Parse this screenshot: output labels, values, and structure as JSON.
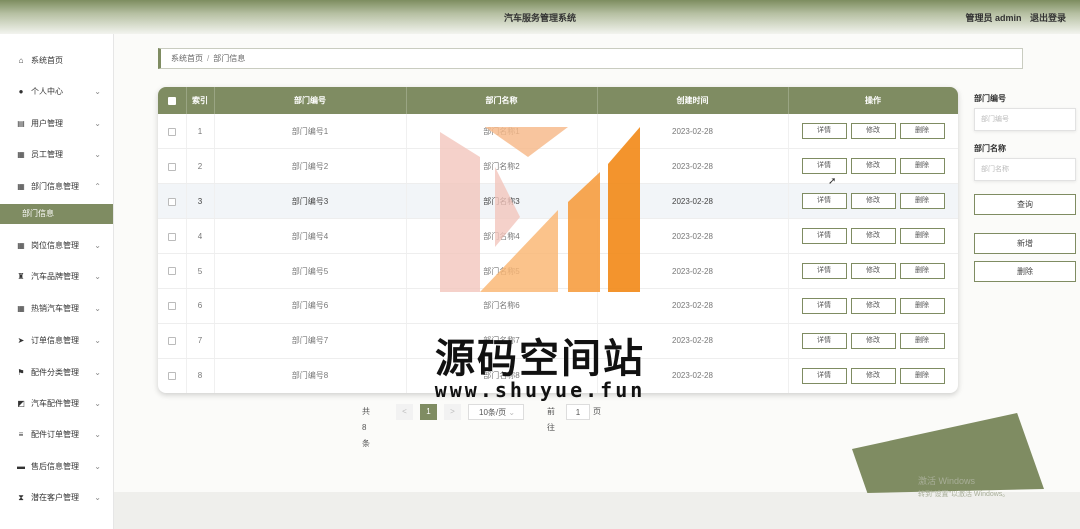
{
  "header": {
    "title": "汽车服务管理系统",
    "user_label": "管理员 admin",
    "logout": "退出登录"
  },
  "sidebar": {
    "items": [
      {
        "label": "系统首页",
        "icon": "home-icon",
        "glyph": "⌂",
        "has_arrow": false
      },
      {
        "label": "个人中心",
        "icon": "user-icon",
        "glyph": "●",
        "has_arrow": true
      },
      {
        "label": "用户管理",
        "icon": "doc-icon",
        "glyph": "▤",
        "has_arrow": true
      },
      {
        "label": "员工管理",
        "icon": "grid-icon",
        "glyph": "▦",
        "has_arrow": true
      },
      {
        "label": "部门信息管理",
        "icon": "grid-icon",
        "glyph": "▦",
        "has_arrow": true,
        "expanded": true
      },
      {
        "label": "部门信息",
        "icon": "",
        "glyph": "",
        "has_arrow": false,
        "active": true
      },
      {
        "label": "岗位信息管理",
        "icon": "grid-icon",
        "glyph": "▦",
        "has_arrow": true
      },
      {
        "label": "汽车品牌管理",
        "icon": "trophy-icon",
        "glyph": "♜",
        "has_arrow": true
      },
      {
        "label": "热销汽车管理",
        "icon": "grid-icon",
        "glyph": "▦",
        "has_arrow": true
      },
      {
        "label": "订单信息管理",
        "icon": "send-icon",
        "glyph": "➤",
        "has_arrow": true
      },
      {
        "label": "配件分类管理",
        "icon": "flag-icon",
        "glyph": "⚑",
        "has_arrow": true
      },
      {
        "label": "汽车配件管理",
        "icon": "chart-icon",
        "glyph": "◩",
        "has_arrow": true
      },
      {
        "label": "配件订单管理",
        "icon": "list-icon",
        "glyph": "≡",
        "has_arrow": true
      },
      {
        "label": "售后信息管理",
        "icon": "chat-icon",
        "glyph": "▬",
        "has_arrow": true
      },
      {
        "label": "潜在客户管理",
        "icon": "hourglass-icon",
        "glyph": "⧗",
        "has_arrow": true
      }
    ]
  },
  "breadcrumb": {
    "home": "系统首页",
    "sep": "/",
    "current": "部门信息"
  },
  "table": {
    "headers": [
      "索引",
      "部门编号",
      "部门名称",
      "创建时间",
      "操作"
    ],
    "rows": [
      {
        "index": "1",
        "code": "部门编号1",
        "name": "部门名称1",
        "date": "2023-02-28"
      },
      {
        "index": "2",
        "code": "部门编号2",
        "name": "部门名称2",
        "date": "2023-02-28"
      },
      {
        "index": "3",
        "code": "部门编号3",
        "name": "部门名称3",
        "date": "2023-02-28"
      },
      {
        "index": "4",
        "code": "部门编号4",
        "name": "部门名称4",
        "date": "2023-02-28"
      },
      {
        "index": "5",
        "code": "部门编号5",
        "name": "部门名称5",
        "date": "2023-02-28"
      },
      {
        "index": "6",
        "code": "部门编号6",
        "name": "部门名称6",
        "date": "2023-02-28"
      },
      {
        "index": "7",
        "code": "部门编号7",
        "name": "部门名称7",
        "date": "2023-02-28"
      },
      {
        "index": "8",
        "code": "部门编号8",
        "name": "部门名称8",
        "date": "2023-02-28"
      }
    ],
    "highlighted_row": 3,
    "actions": {
      "detail": "详情",
      "edit": "修改",
      "delete": "删除"
    }
  },
  "pagination": {
    "total": "共 8 条",
    "prev": "<",
    "current": "1",
    "next": ">",
    "page_size": "10条/页",
    "goto_prefix": "前往",
    "goto_value": "1",
    "goto_suffix": "页"
  },
  "search": {
    "code_label": "部门编号",
    "code_placeholder": "部门编号",
    "name_label": "部门名称",
    "name_placeholder": "部门名称",
    "query_button": "查询",
    "add_button": "新增",
    "delete_button": "删除"
  },
  "overlay": {
    "activation_title": "激活 Windows",
    "activation_sub": "转到\"设置\"以激活 Windows。",
    "watermark_cn": "源码空间站",
    "watermark_url": "www.shuyue.fun"
  },
  "colors": {
    "primary": "#7f8c62",
    "logo_orange": "#f28c1c",
    "logo_pink": "#f2c4bb"
  }
}
